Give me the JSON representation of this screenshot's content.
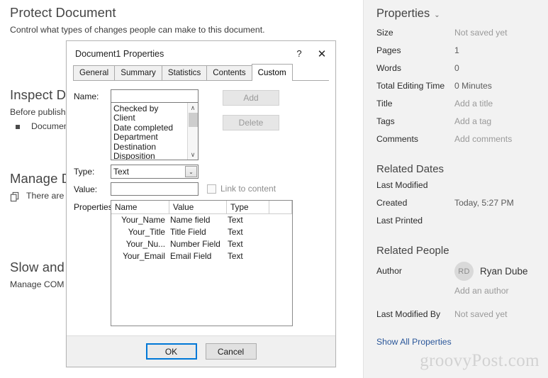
{
  "backdrop": {
    "sections": [
      {
        "heading": "Protect Document",
        "sub": "Control what types of changes people can make to this document.",
        "bullet": "",
        "icon": ""
      },
      {
        "heading": "Inspect Do",
        "sub": "Before publishin",
        "bullet": "Document p",
        "icon": "bullet-square-icon"
      },
      {
        "heading": "Manage D",
        "sub": "",
        "bullet": "There are n",
        "icon": "documents-icon"
      },
      {
        "heading": "Slow and D",
        "sub": "Manage COM ad",
        "bullet": "",
        "icon": ""
      }
    ]
  },
  "properties_panel": {
    "title": "Properties",
    "chevron": "⌄",
    "rows": [
      {
        "key": "Size",
        "value": "Not saved yet",
        "dim": true
      },
      {
        "key": "Pages",
        "value": "1",
        "dim": false
      },
      {
        "key": "Words",
        "value": "0",
        "dim": false
      },
      {
        "key": "Total Editing Time",
        "value": "0 Minutes",
        "dim": false
      },
      {
        "key": "Title",
        "value": "Add a title",
        "dim": true
      },
      {
        "key": "Tags",
        "value": "Add a tag",
        "dim": true
      },
      {
        "key": "Comments",
        "value": "Add comments",
        "dim": true
      }
    ],
    "related_dates": {
      "heading": "Related Dates",
      "rows": [
        {
          "key": "Last Modified",
          "value": ""
        },
        {
          "key": "Created",
          "value": "Today, 5:27 PM"
        },
        {
          "key": "Last Printed",
          "value": ""
        }
      ]
    },
    "related_people": {
      "heading": "Related People",
      "author_label": "Author",
      "author_initials": "RD",
      "author_name": "Ryan Dube",
      "add_author": "Add an author",
      "last_modified_by_label": "Last Modified By",
      "last_modified_by_value": "Not saved yet"
    },
    "show_all": "Show All Properties",
    "link_color": "#2b579a"
  },
  "watermark": "groovyPost.com",
  "dialog": {
    "title": "Document1 Properties",
    "help_glyph": "?",
    "close_glyph": "✕",
    "tabs": [
      {
        "label": "General",
        "active": false
      },
      {
        "label": "Summary",
        "active": false
      },
      {
        "label": "Statistics",
        "active": false
      },
      {
        "label": "Contents",
        "active": false
      },
      {
        "label": "Custom",
        "active": true
      }
    ],
    "labels": {
      "name": "Name:",
      "type": "Type:",
      "value": "Value:",
      "properties": "Properties:"
    },
    "name_input": {
      "value": "",
      "placeholder": ""
    },
    "name_list": [
      "Checked by",
      "Client",
      "Date completed",
      "Department",
      "Destination",
      "Disposition"
    ],
    "scroll": {
      "up": "∧",
      "down": "∨"
    },
    "type_select": {
      "value": "Text",
      "arrow": "⌄"
    },
    "value_input": {
      "value": "",
      "placeholder": ""
    },
    "link_to_content": {
      "label": "Link to content",
      "checked": false
    },
    "add_button": "Add",
    "delete_button": "Delete",
    "table": {
      "columns": [
        "Name",
        "Value",
        "Type"
      ],
      "rows": [
        [
          "Your_Name",
          "Name field",
          "Text"
        ],
        [
          "Your_Title",
          "Title Field",
          "Text"
        ],
        [
          "Your_Nu...",
          "Number Field",
          "Text"
        ],
        [
          "Your_Email",
          "Email Field",
          "Text"
        ]
      ]
    },
    "ok_button": "OK",
    "cancel_button": "Cancel",
    "accent_color": "#0078d7"
  }
}
